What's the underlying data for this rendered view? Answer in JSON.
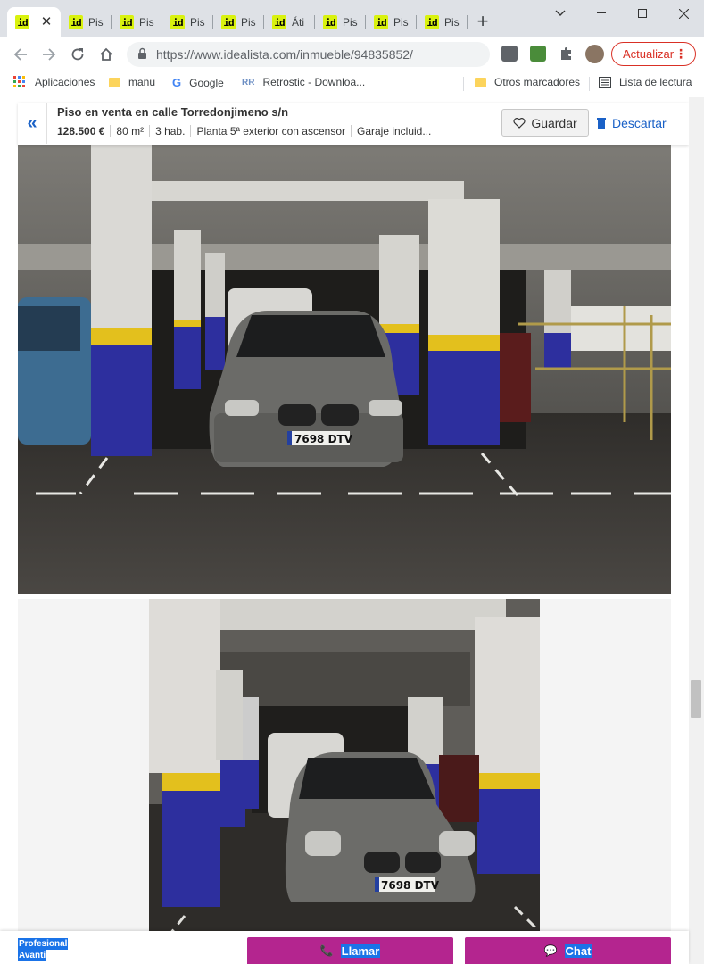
{
  "browser": {
    "tabs": [
      {
        "label": "",
        "favicon": "id",
        "active": true
      },
      {
        "label": "Pis",
        "favicon": "id"
      },
      {
        "label": "Pis",
        "favicon": "id"
      },
      {
        "label": "Pis",
        "favicon": "id"
      },
      {
        "label": "Pis",
        "favicon": "id"
      },
      {
        "label": "Áti",
        "favicon": "id"
      },
      {
        "label": "Pis",
        "favicon": "id"
      },
      {
        "label": "Pis",
        "favicon": "id"
      },
      {
        "label": "Pis",
        "favicon": "id"
      }
    ],
    "url_host": "https://www.idealista.com",
    "url_path": "/inmueble/94835852/",
    "update_label": "Actualizar",
    "bookmarks": {
      "apps": "Aplicaciones",
      "b1": "manu",
      "b2": "Google",
      "b3": "Retrostic - Downloa...",
      "other": "Otros marcadores",
      "reading": "Lista de lectura"
    }
  },
  "listing": {
    "title": "Piso en venta en calle Torredonjimeno s/n",
    "price": "128.500 €",
    "area": "80 m²",
    "rooms": "3 hab.",
    "floor": "Planta 5ª exterior con ascensor",
    "garage": "Garaje incluid...",
    "save_label": "Guardar",
    "discard_label": "Descartar",
    "plate": "7698 DTV"
  },
  "footer": {
    "agency_line1": "Profesional",
    "agency_line2": "Avanti",
    "call_label": "Llamar",
    "chat_label": "Chat"
  },
  "colors": {
    "favicon": "#d9f20f",
    "brand_blue": "#1a61c7",
    "cta": "#b4258f",
    "pillar_blue": "#2d2f9e",
    "pillar_yellow": "#e3c01d"
  }
}
